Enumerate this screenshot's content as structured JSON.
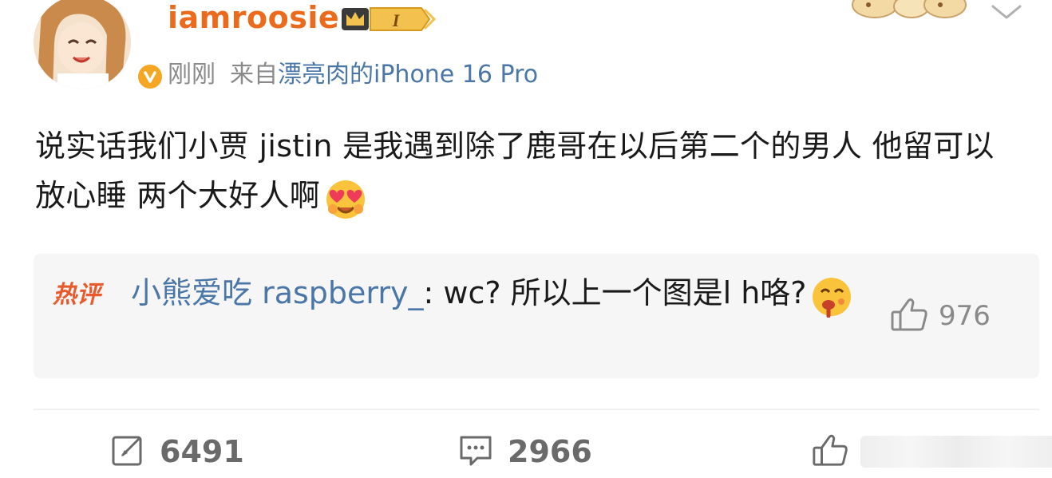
{
  "post": {
    "user": {
      "name": "iamroosie",
      "level_badge": "I"
    },
    "meta": {
      "time": "刚刚",
      "source_label": "来自",
      "device": "漂亮肉的iPhone 16 Pro"
    },
    "text_main": "说实话我们小贾 jistin 是我遇到除了鹿哥在以后第二个的男人 他留可以放心睡 两个大好人啊",
    "text_emoji": "heart-eyes-emoji"
  },
  "hot_comment": {
    "tag": "热评",
    "author": "小熊爱吃 raspberry_",
    "text": ": wc?  所以上一个图是l h咯?",
    "emoji": "drooling-face-emoji",
    "likes": "976"
  },
  "actions": {
    "reposts": "6491",
    "comments": "2966",
    "likes": ""
  },
  "colors": {
    "username": "#ec6a1c",
    "link": "#4a76a8",
    "hot_tag": "#e85a2b",
    "verified": "#f5a623",
    "muted": "#8a8a8a"
  },
  "icons": [
    "verified-icon",
    "crown-level-badge",
    "chevron-down-icon",
    "heart-eyes-emoji",
    "drooling-face-emoji",
    "thumb-up-icon",
    "repost-icon",
    "comment-icon",
    "like-icon"
  ]
}
